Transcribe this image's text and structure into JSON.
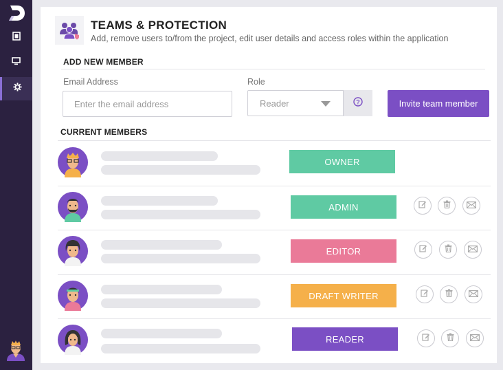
{
  "sidebar": {
    "items": [
      {
        "icon": "document-icon",
        "active": false
      },
      {
        "icon": "monitor-icon",
        "active": false
      },
      {
        "icon": "gear-icon",
        "active": true
      }
    ]
  },
  "header": {
    "title": "TEAMS & PROTECTION",
    "subtitle": "Add, remove users to/from the project, edit user details and access roles within the application",
    "icon": "team-icon"
  },
  "add_member": {
    "section_title": "ADD NEW MEMBER",
    "email_label": "Email Address",
    "email_placeholder": "Enter the email address",
    "role_label": "Role",
    "role_value": "Reader",
    "invite_label": "Invite team member"
  },
  "members": {
    "section_title": "CURRENT MEMBERS",
    "rows": [
      {
        "role": "OWNER",
        "color": "#5fcaa3",
        "actions": false
      },
      {
        "role": "ADMIN",
        "color": "#5fcaa3",
        "actions": true
      },
      {
        "role": "EDITOR",
        "color": "#ea7a98",
        "actions": true
      },
      {
        "role": "DRAFT WRITER",
        "color": "#f5b04a",
        "actions": true
      },
      {
        "role": "READER",
        "color": "#7b4fc4",
        "actions": true
      }
    ]
  },
  "colors": {
    "sidebar": "#2b2140",
    "accent": "#7b4fc4",
    "owner": "#5fcaa3",
    "admin": "#5fcaa3",
    "editor": "#ea7a98",
    "draft_writer": "#f5b04a",
    "reader": "#7b4fc4"
  }
}
